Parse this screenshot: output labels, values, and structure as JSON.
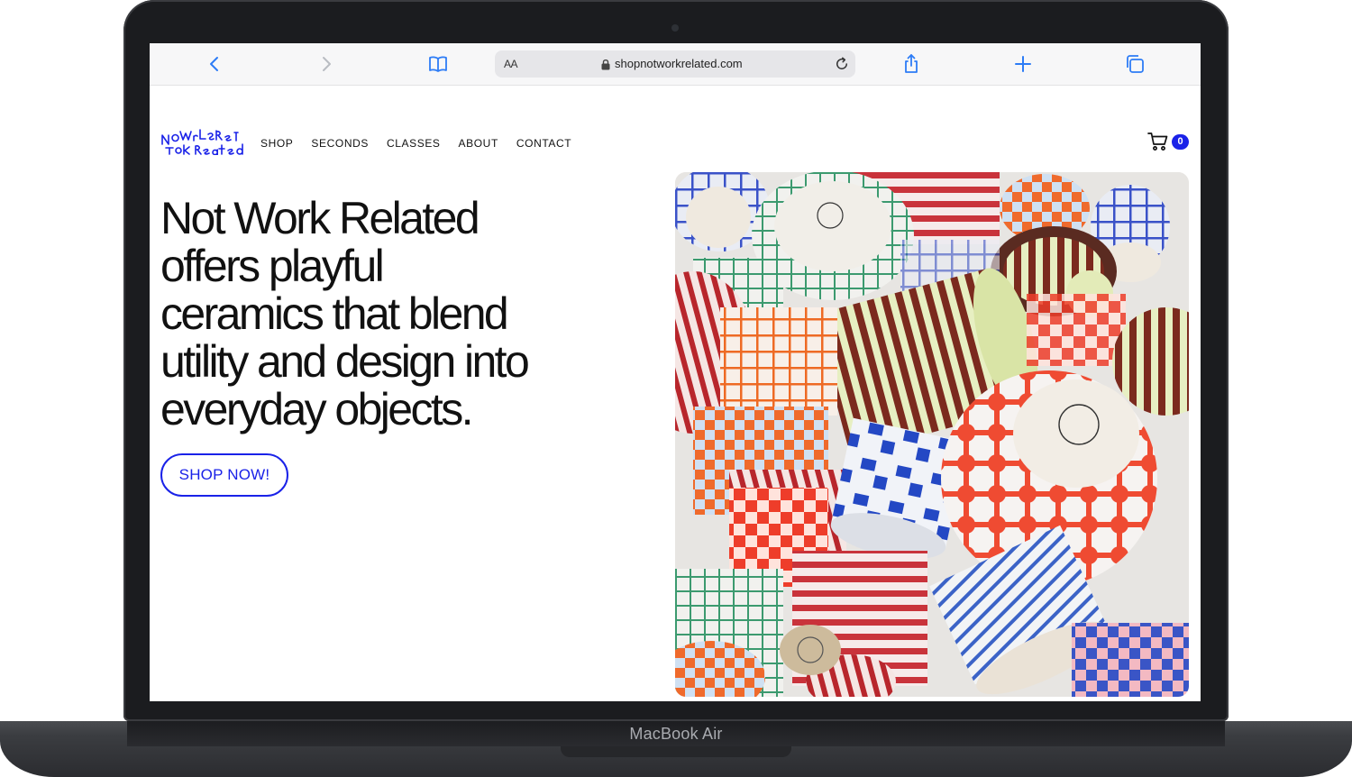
{
  "device": {
    "model_label": "MacBook Air"
  },
  "browser": {
    "aa_label": "AA",
    "url": "shopnotworkrelated.com",
    "accent": "#2d7cf6"
  },
  "site": {
    "brand_color": "#1a22e8",
    "logo_text": "Not Work Related",
    "nav": [
      {
        "label": "SHOP"
      },
      {
        "label": "SECONDS"
      },
      {
        "label": "CLASSES"
      },
      {
        "label": "ABOUT"
      },
      {
        "label": "CONTACT"
      }
    ],
    "cart_count": "0",
    "hero": {
      "lines": [
        "Not Work Related",
        "offers playful",
        "ceramics that blend",
        "utility and design into",
        "everyday objects."
      ],
      "cta_label": "SHOP NOW!"
    }
  }
}
